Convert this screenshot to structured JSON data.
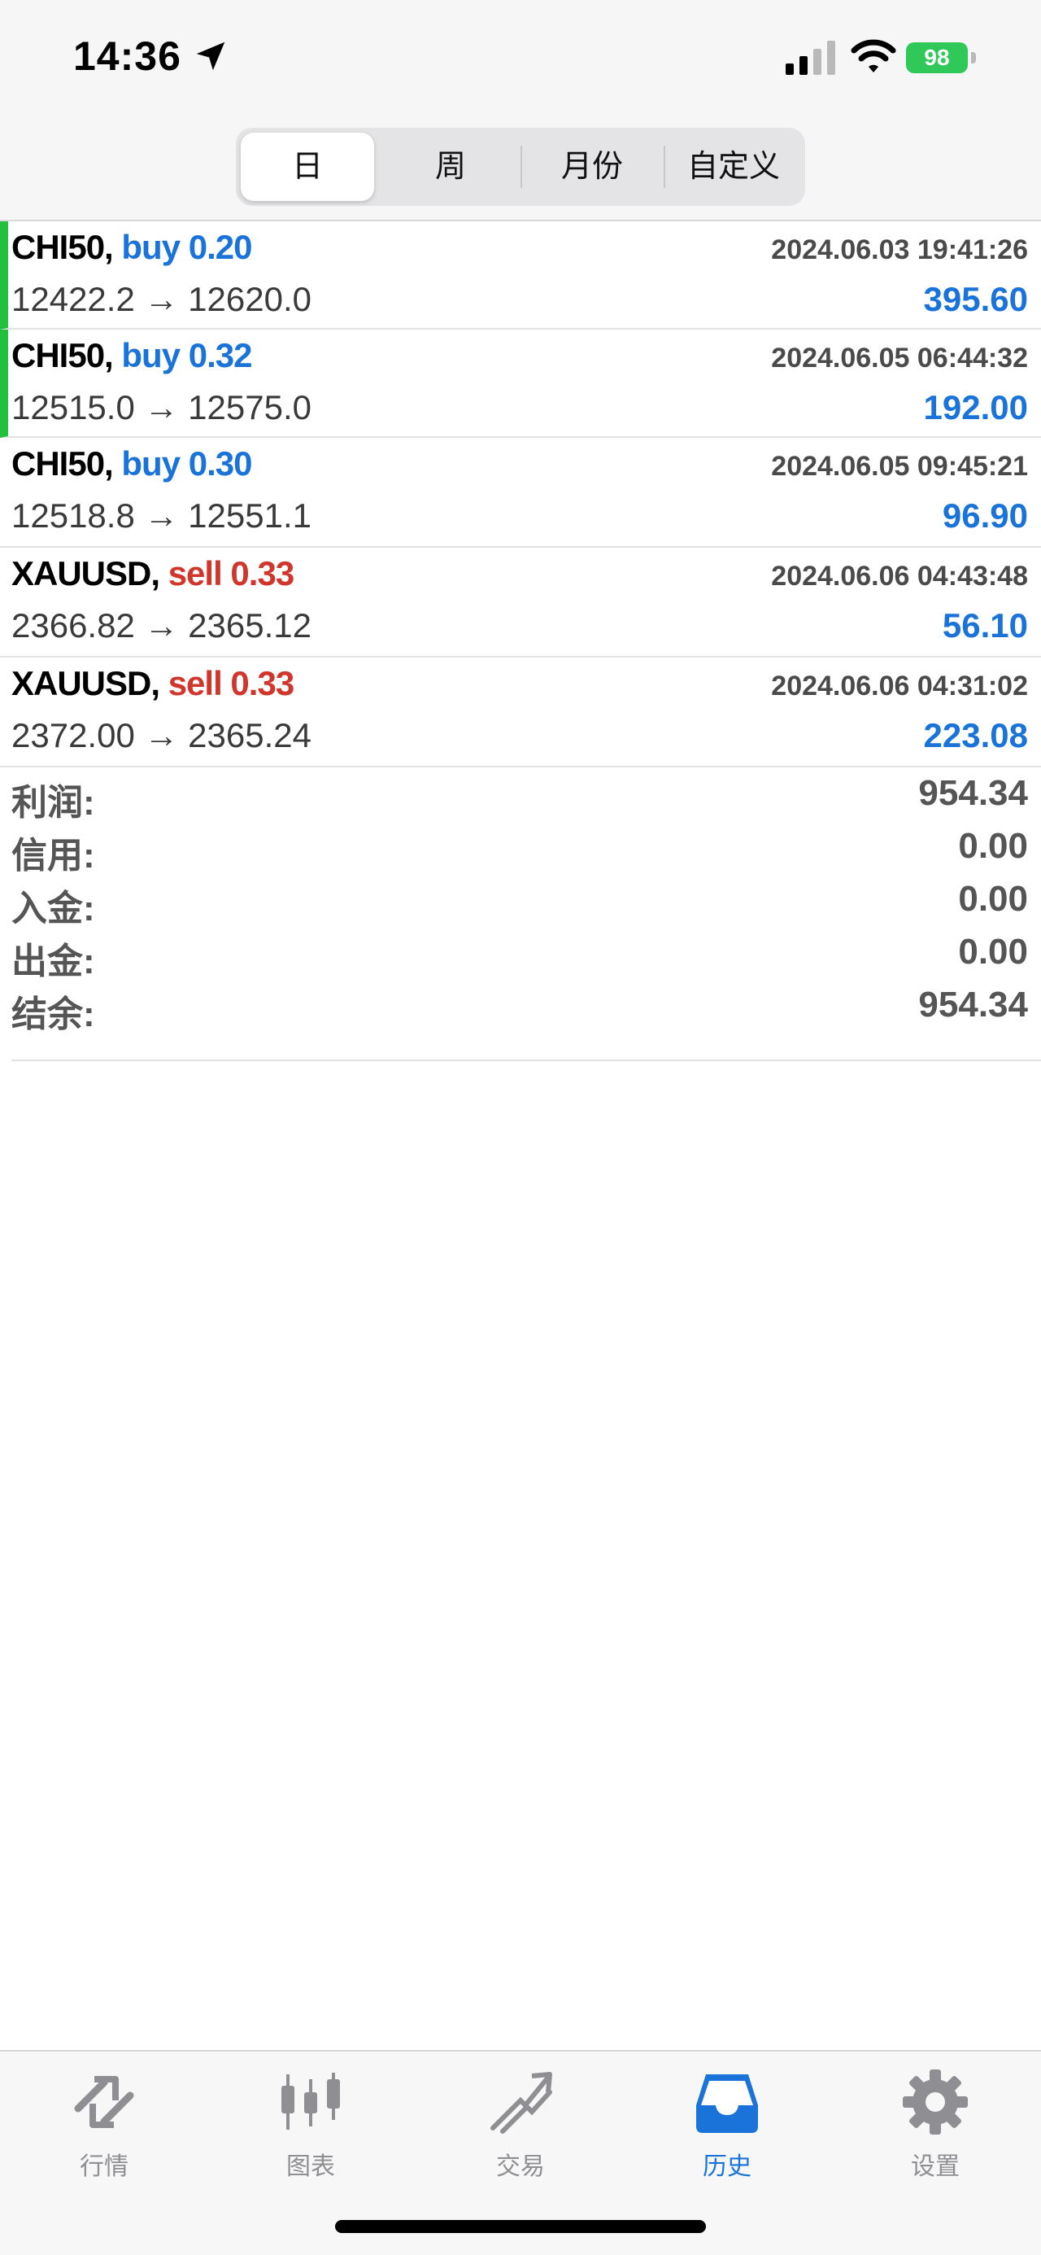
{
  "status_bar": {
    "time": "14:36",
    "battery": "98"
  },
  "period_tabs": [
    {
      "label": "日",
      "selected": true
    },
    {
      "label": "周",
      "selected": false
    },
    {
      "label": "月份",
      "selected": false
    },
    {
      "label": "自定义",
      "selected": false
    }
  ],
  "trades": [
    {
      "symbol": "CHI50,",
      "side": "buy 0.20",
      "type": "buy",
      "time": "2024.06.03 19:41:26",
      "prices": "12422.2 → 12620.0",
      "profit": "395.60",
      "accent": true
    },
    {
      "symbol": "CHI50,",
      "side": "buy 0.32",
      "type": "buy",
      "time": "2024.06.05 06:44:32",
      "prices": "12515.0 → 12575.0",
      "profit": "192.00",
      "accent": true
    },
    {
      "symbol": "CHI50,",
      "side": "buy 0.30",
      "type": "buy",
      "time": "2024.06.05 09:45:21",
      "prices": "12518.8 → 12551.1",
      "profit": "96.90",
      "accent": false
    },
    {
      "symbol": "XAUUSD,",
      "side": "sell 0.33",
      "type": "sell",
      "time": "2024.06.06 04:43:48",
      "prices": "2366.82 → 2365.12",
      "profit": "56.10",
      "accent": false
    },
    {
      "symbol": "XAUUSD,",
      "side": "sell 0.33",
      "type": "sell",
      "time": "2024.06.06 04:31:02",
      "prices": "2372.00 → 2365.24",
      "profit": "223.08",
      "accent": false
    }
  ],
  "summary": [
    {
      "label": "利润:",
      "value": "954.34"
    },
    {
      "label": "信用:",
      "value": "0.00"
    },
    {
      "label": "入金:",
      "value": "0.00"
    },
    {
      "label": "出金:",
      "value": "0.00"
    },
    {
      "label": "结余:",
      "value": "954.34"
    }
  ],
  "tab_bar": [
    {
      "label": "行情",
      "icon": "quotes-icon",
      "active": false
    },
    {
      "label": "图表",
      "icon": "chart-icon",
      "active": false
    },
    {
      "label": "交易",
      "icon": "trade-icon",
      "active": false
    },
    {
      "label": "历史",
      "icon": "history-icon",
      "active": true
    },
    {
      "label": "设置",
      "icon": "settings-icon",
      "active": false
    }
  ],
  "colors": {
    "buy": "#1a73d9",
    "sell": "#d0362b",
    "accent_bar": "#22c03c",
    "active_tab": "#1a73d9",
    "inactive_tab": "#8e8e93"
  }
}
